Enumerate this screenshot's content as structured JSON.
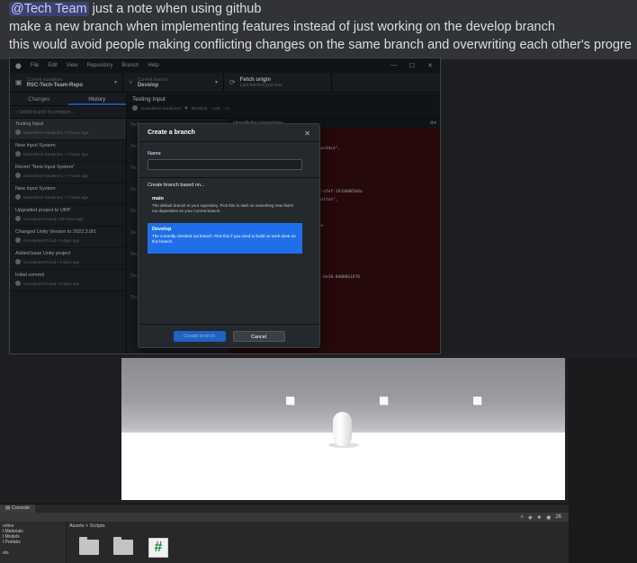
{
  "message": {
    "mention": "@Tech Team",
    "line1_rest": " just a note when using github",
    "line2": "make a new branch when implementing features instead of just working on the develop branch",
    "line3": "this would avoid people making conflicting changes on the same branch and overwriting each other's progre"
  },
  "github": {
    "menu": [
      "File",
      "Edit",
      "View",
      "Repository",
      "Branch",
      "Help"
    ],
    "window_controls": [
      "—",
      "☐",
      "✕"
    ],
    "toolbar": {
      "repo_label": "Current repository",
      "repo_value": "RSC-Tech-Team-Repo",
      "branch_label": "Current branch",
      "branch_value": "Develop",
      "fetch_label": "Fetch origin",
      "fetch_sub": "Last fetched just now"
    },
    "tabs": [
      "Changes",
      "History"
    ],
    "filter_placeholder": "Select branch to compare...",
    "commits": [
      {
        "title": "Testing Input",
        "meta": "DanielOsei-StudentAc • 2 hours ago"
      },
      {
        "title": "New Input System",
        "meta": "DanielOsei-StudentAc • 7 hours ago"
      },
      {
        "title": "Revert \"New Input System\"",
        "meta": "DanielOsei-StudentAc • 7 hours ago"
      },
      {
        "title": "New Input System",
        "meta": "DanielOsei-StudentAc • 7 hours ago"
      },
      {
        "title": "Upgraded project to URP",
        "meta": "incompetentTroud • 23 hours ago"
      },
      {
        "title": "Changed Unity Version to 2022.3.0f1",
        "meta": "incompetentTroud • 2 days ago"
      },
      {
        "title": "Added base Unity project",
        "meta": "incompetentTroud • 5 days ago"
      },
      {
        "title": "Initial commit",
        "meta": "incompetentTroud • 5 days ago"
      }
    ],
    "main_title": "Testing Input",
    "main_author": "DanielOsei-StudentAc",
    "main_sha": "b678b0a",
    "main_add": "+106",
    "main_del": "-14",
    "file_rows": [
      "Tech",
      "Tech",
      "Tech",
      "Tech",
      "Tech",
      "Tech",
      "Tech",
      "Tech",
      "Tech"
    ],
    "diff_file": "nInputAction.inputactions",
    "diff_lines": [
      "",
      "",
      "    perInputAction\",",
      "",
      "  me\": \"Player\",",
      "  \": \"17d717a6-7271-495d-9f00-62574eac44ce\",",
      "  tions\": [",
      "       {",
      "           \"name\": \"New action\",",
      "           \"type\": \"Button\",",
      "           \"id\": \"9dbd11a1-a613-45cf-afef-19330085b8a",
      "",
      "           \"expectedControlType\": \"Button\",",
      "           \"processors\": \"\",",
      "           \"interactions\": \"\",",
      "           \"initialStateCheck\": false",
      "       }",
      "  ],",
      "  \"bindings\": [",
      "       {",
      "           \"name\": \"\",",
      "           \"id\": \"19b0ef3f-65b7-4277-be10-0d008b1678",
      "  bc\",",
      "           \"path\": \"\","
    ],
    "modal": {
      "title": "Create a branch",
      "name_label": "Name",
      "based_on_label": "Create branch based on...",
      "options": [
        {
          "name": "main",
          "desc": "The default branch in your repository. Pick this to start on something new that's not dependent on your current branch."
        },
        {
          "name": "Develop",
          "desc": "The currently checked out branch. Pick this if you need to build on work done on this branch."
        }
      ],
      "create_label": "Create branch",
      "cancel_label": "Cancel"
    }
  },
  "unity": {
    "console_tab": "Console",
    "tree": [
      "orites",
      "l Materials",
      "l Models",
      "l Prefabs",
      "",
      "ets"
    ],
    "breadcrumb": "Assets > Scripts",
    "script_glyph": "#",
    "toolbar_icons": [
      "search-icon",
      "filter-icon",
      "star-icon",
      "eye-icon",
      "count-badge"
    ],
    "count": "26"
  }
}
